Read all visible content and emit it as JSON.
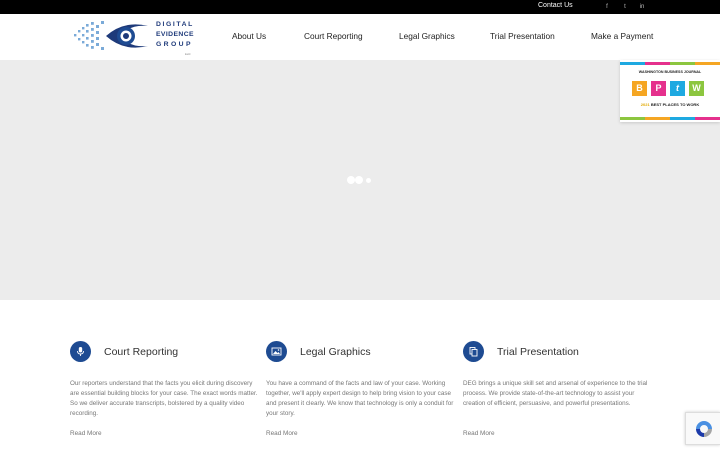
{
  "topbar": {
    "contact_label": "Contact Us",
    "social": [
      {
        "icon": "facebook-icon",
        "glyph": "f"
      },
      {
        "icon": "twitter-icon",
        "glyph": "t"
      },
      {
        "icon": "linkedin-icon",
        "glyph": "in"
      }
    ]
  },
  "logo": {
    "line1": "DIGITAL",
    "line2": "EVIDENCE",
    "line3": "GROUP",
    "suffix": "LLC"
  },
  "nav": {
    "items": [
      {
        "label": "About Us"
      },
      {
        "label": "Court Reporting"
      },
      {
        "label": "Legal Graphics"
      },
      {
        "label": "Trial Presentation"
      },
      {
        "label": "Make a Payment"
      }
    ]
  },
  "badge": {
    "publisher": "WASHINGTON BUSINESS JOURNAL",
    "letters": [
      "B",
      "P",
      "t",
      "W"
    ],
    "year": "2021",
    "award": "BEST PLACES TO WORK",
    "colors": [
      "#f5a623",
      "#e5318d",
      "#1ea9e1",
      "#8cc63f"
    ]
  },
  "services": [
    {
      "icon": "microphone-icon",
      "title": "Court Reporting",
      "description": "Our reporters understand that the facts you elicit during discovery are essential building blocks for your case. The exact words matter. So we deliver accurate transcripts, bolstered by a quality video recording.",
      "link": "Read More"
    },
    {
      "icon": "image-icon",
      "title": "Legal Graphics",
      "description": "You have a command of the facts and law of your case. Working together, we'll apply expert design to help bring vision to your case and present it clearly. We know that technology is only a conduit for your story.",
      "link": "Read More"
    },
    {
      "icon": "documents-icon",
      "title": "Trial Presentation",
      "description": "DEG brings a unique skill set and arsenal of experience to the trial process. We provide state-of-the-art technology to assist your creation of efficient, persuasive, and powerful presentations.",
      "link": "Read More"
    }
  ],
  "colors": {
    "brand_blue": "#1e4b92",
    "topbar": "#000000",
    "hero_bg": "#ececec"
  }
}
